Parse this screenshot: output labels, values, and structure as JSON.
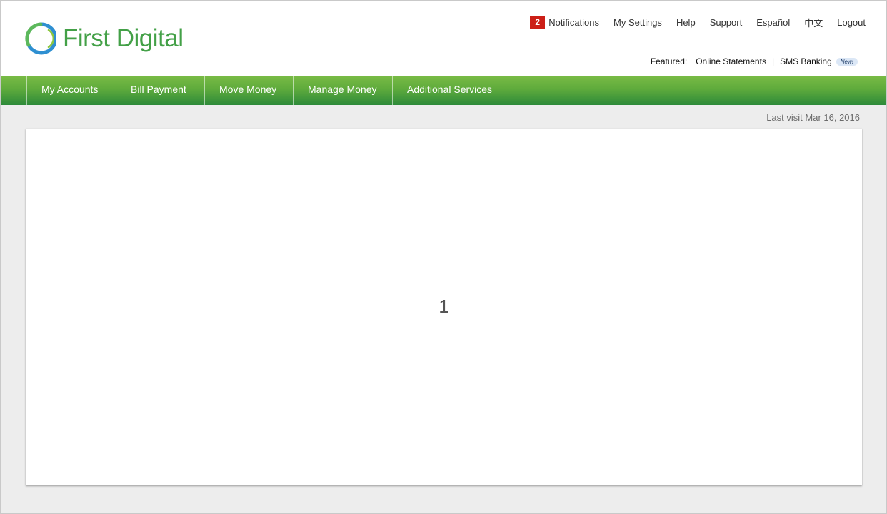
{
  "brand": {
    "name": "First Digital",
    "color": "#43a047"
  },
  "utility_nav": {
    "notifications": {
      "count": "2",
      "label": "Notifications"
    },
    "links": [
      "My Settings",
      "Help",
      "Support",
      "Español",
      "中文",
      "Logout"
    ]
  },
  "featured": {
    "label": "Featured:",
    "links": [
      "Online Statements",
      "SMS Banking"
    ],
    "separator": "|",
    "new_badge": "New!"
  },
  "main_nav": {
    "items": [
      "My Accounts",
      "Bill Payment",
      "Move Money",
      "Manage Money",
      "Additional Services"
    ]
  },
  "last_visit": "Last visit Mar 16, 2016",
  "content": {
    "number": "1"
  },
  "colors": {
    "nav_green": "#5fab3c",
    "badge_red": "#cc1f17",
    "background": "#ededed"
  }
}
